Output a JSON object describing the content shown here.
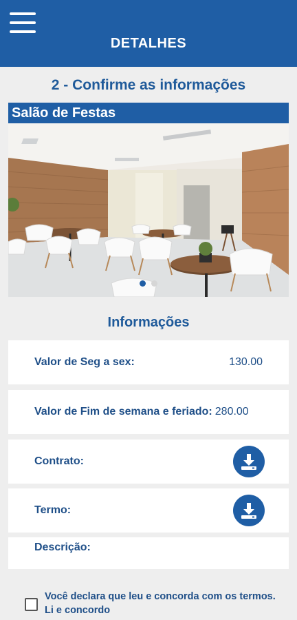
{
  "header": {
    "title": "DETALHES",
    "menu_icon": "hamburger-menu-icon",
    "background": "#1f5ea5"
  },
  "step": {
    "title": "2 - Confirme as informações"
  },
  "gallery": {
    "title": "Salão de Festas",
    "slide_count": 2,
    "active_slide": 1
  },
  "info": {
    "title": "Informações",
    "weekday_label": "Valor de Seg a sex:",
    "weekday_value": "130.00",
    "weekend_label": "Valor de Fim de semana e feriado:",
    "weekend_value": "280.00",
    "contract_label": "Contrato:",
    "contract_icon": "download-icon",
    "term_label": "Termo:",
    "term_icon": "download-icon",
    "description_label": "Descrição:"
  },
  "agreement": {
    "text": "Você declara que leu e concorda com os termos. Li e concordo",
    "checked": false
  },
  "colors": {
    "accent": "#1f5ea5",
    "text": "#1f4f88",
    "background": "#eeeeee"
  }
}
